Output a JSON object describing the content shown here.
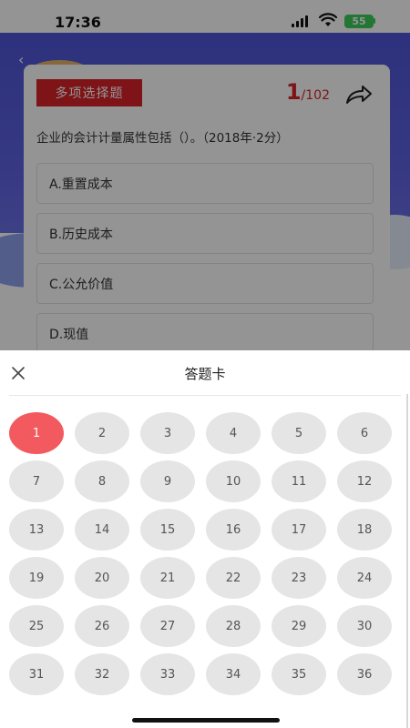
{
  "status_bar": {
    "time": "17:36",
    "battery": "55"
  },
  "question": {
    "type_label": "多项选择题",
    "current": "1",
    "separator": "/",
    "total": "102",
    "text": "企业的会计计量属性包括（）。（2018年·2分）",
    "options": [
      "A.重置成本",
      "B.历史成本",
      "C.公允价值",
      "D.现值"
    ]
  },
  "answer_card": {
    "title": "答题卡",
    "numbers": [
      "1",
      "2",
      "3",
      "4",
      "5",
      "6",
      "7",
      "8",
      "9",
      "10",
      "11",
      "12",
      "13",
      "14",
      "15",
      "16",
      "17",
      "18",
      "19",
      "20",
      "21",
      "22",
      "23",
      "24",
      "25",
      "26",
      "27",
      "28",
      "29",
      "30",
      "31",
      "32",
      "33",
      "34",
      "35",
      "36"
    ],
    "active_color": "#f25a5f"
  },
  "colors": {
    "accent": "#d9242a",
    "hero": "#4f54d6"
  },
  "icons": {
    "back": "chevron-left-icon",
    "share": "share-icon",
    "close": "close-icon"
  }
}
